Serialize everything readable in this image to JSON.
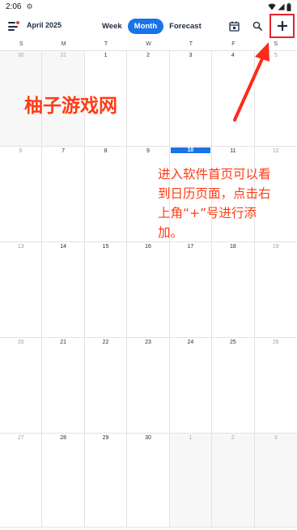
{
  "status_bar": {
    "time": "2:06",
    "icons": [
      "settings-gear-icon",
      "wifi-icon",
      "signal-icon",
      "battery-icon"
    ]
  },
  "header": {
    "month_label": "April 2025",
    "tabs": [
      {
        "label": "Week",
        "active": false
      },
      {
        "label": "Month",
        "active": true
      },
      {
        "label": "Forecast",
        "active": false
      }
    ],
    "actions": [
      "calendar-today-icon",
      "search-icon",
      "add-icon"
    ]
  },
  "weekdays": [
    "S",
    "M",
    "T",
    "W",
    "T",
    "F",
    "S"
  ],
  "calendar": {
    "weeks": [
      [
        {
          "d": "30",
          "o": true
        },
        {
          "d": "31",
          "o": true
        },
        {
          "d": "1"
        },
        {
          "d": "2"
        },
        {
          "d": "3"
        },
        {
          "d": "4"
        },
        {
          "d": "5"
        }
      ],
      [
        {
          "d": "6"
        },
        {
          "d": "7"
        },
        {
          "d": "8"
        },
        {
          "d": "9"
        },
        {
          "d": "10",
          "today": true
        },
        {
          "d": "11"
        },
        {
          "d": "12"
        }
      ],
      [
        {
          "d": "13"
        },
        {
          "d": "14"
        },
        {
          "d": "15"
        },
        {
          "d": "16"
        },
        {
          "d": "17"
        },
        {
          "d": "18"
        },
        {
          "d": "19"
        }
      ],
      [
        {
          "d": "20"
        },
        {
          "d": "21"
        },
        {
          "d": "22"
        },
        {
          "d": "23"
        },
        {
          "d": "24"
        },
        {
          "d": "25"
        },
        {
          "d": "26"
        }
      ],
      [
        {
          "d": "27"
        },
        {
          "d": "28"
        },
        {
          "d": "29"
        },
        {
          "d": "30"
        },
        {
          "d": "1",
          "o": true
        },
        {
          "d": "2",
          "o": true
        },
        {
          "d": "3",
          "o": true
        }
      ]
    ]
  },
  "overlay": {
    "watermark": "柚子游戏网",
    "instruction": "进入软件首页可以看到日历页面，点击右上角“+”号进行添加。"
  },
  "colors": {
    "accent": "#1a73e8",
    "annotation_red": "#ff3b14",
    "highlight_box": "#e8212a"
  }
}
